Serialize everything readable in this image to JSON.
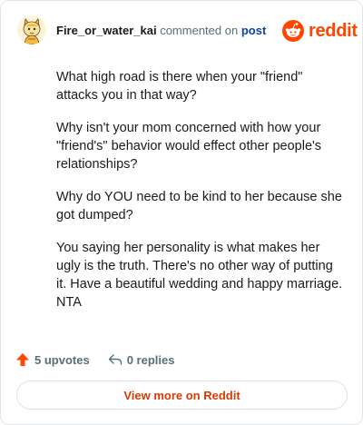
{
  "comment": {
    "username": "Fire_or_water_kai",
    "action_text": "commented on",
    "post_link": "post",
    "paragraphs": [
      "What high road is there when your \"friend\" attacks you in that way?",
      "Why isn't your mom concerned with how your \"friend's\" behavior would effect other people's relationships?",
      "Why do YOU need to be kind to her because she got dumped?",
      "You saying her personality is what makes her ugly is the truth. There's no other way of putting it. Have a beautiful wedding and happy marriage. NTA"
    ]
  },
  "brand": {
    "name": "reddit",
    "icon": "reddit-snoo-icon",
    "color": "#ff4500"
  },
  "actions": {
    "upvotes": "5 upvotes",
    "replies": "0 replies",
    "upvote_icon": "upvote-arrow-icon",
    "reply_icon": "reply-arrow-icon",
    "upvote_color": "#ff4500"
  },
  "view_more": {
    "label": "View more on Reddit",
    "color": "#d93a00"
  },
  "avatar": {
    "icon": "user-avatar-icon"
  }
}
